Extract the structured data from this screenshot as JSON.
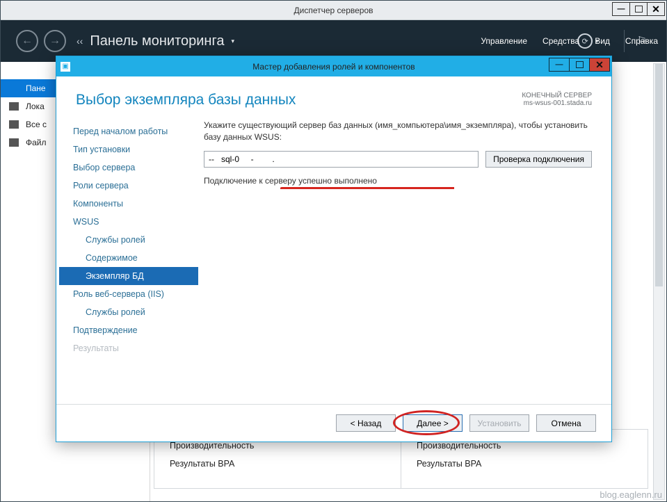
{
  "serverManager": {
    "windowTitle": "Диспетчер серверов",
    "breadcrumbLabel": "Панель мониторинга",
    "menu": {
      "manage": "Управление",
      "tools": "Средства",
      "view": "Вид",
      "help": "Справка"
    },
    "sidebar": {
      "dashboard": "Пане",
      "local": "Лока",
      "all": "Все с",
      "file": "Файл"
    },
    "columns": {
      "perf": "Производительность",
      "bpa": "Результаты BPA"
    },
    "watermark": "blog.eaglenn.ru"
  },
  "wizard": {
    "title": "Мастер добавления ролей и компонентов",
    "pageTitle": "Выбор экземпляра базы данных",
    "destination": {
      "label": "КОНЕЧНЫЙ СЕРВЕР",
      "server": "ms-wsus-001.stada.ru"
    },
    "steps": {
      "before": "Перед началом работы",
      "type": "Тип установки",
      "server": "Выбор сервера",
      "serverRoles": "Роли сервера",
      "features": "Компоненты",
      "wsus": "WSUS",
      "wsusRoles": "Службы ролей",
      "content": "Содержимое",
      "dbInstance": "Экземпляр БД",
      "iis": "Роль веб-сервера (IIS)",
      "iisRoles": "Службы ролей",
      "confirm": "Подтверждение",
      "results": "Результаты"
    },
    "instruction": "Укажите существующий сервер баз данных (имя_компьютера\\имя_экземпляра), чтобы установить базу данных WSUS:",
    "dbValue": "--   sql-0     -        .",
    "checkBtn": "Проверка подключения",
    "status": "Подключение к серверу успешно выполнено",
    "buttons": {
      "back": "< Назад",
      "next": "Далее >",
      "install": "Установить",
      "cancel": "Отмена"
    }
  }
}
